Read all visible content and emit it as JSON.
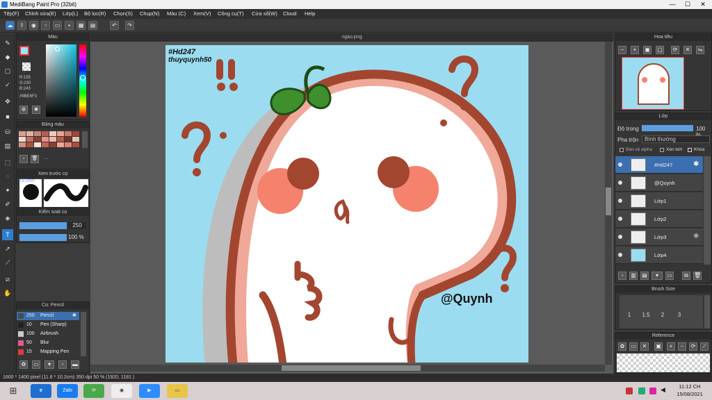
{
  "window": {
    "title": "MediBang Paint Pro (32bit)",
    "minimize": "—",
    "maximize": "☐",
    "close": "✕"
  },
  "menu": [
    "Tệp(F)",
    "Chỉnh sửa(E)",
    "Lớp(L)",
    "Bộ lọc(R)",
    "Chọn(S)",
    "Chụp(N)",
    "Màu (C)",
    "Xem(V)",
    "Công cụ(T)",
    "Cửa sổ(W)",
    "Cloud",
    "Help"
  ],
  "document": {
    "tab": "ngao.png"
  },
  "color_panel": {
    "title": "Màu",
    "r": "R:155",
    "g": "G:230",
    "b": "B:243",
    "hex": "#9BE6F3"
  },
  "palette_panel": {
    "title": "Bảng màu"
  },
  "brush_preview": {
    "title": "Xem trước cọ",
    "size": "18.2mm"
  },
  "brush_control": {
    "title": "Kiểm soát cọ",
    "size": "250",
    "opacity": "100 %"
  },
  "brush_list": {
    "title": "Cọ: Pencil",
    "items": [
      {
        "size": "250",
        "name": "Pencil",
        "color": "#4a4a4a"
      },
      {
        "size": "10",
        "name": "Pen (Sharp)",
        "color": "#222222"
      },
      {
        "size": "100",
        "name": "Airbrush",
        "color": "#cccccc"
      },
      {
        "size": "50",
        "name": "Blur",
        "color": "#e05a8a"
      },
      {
        "size": "15",
        "name": "Mapping Pen",
        "color": "#e03a3a"
      }
    ]
  },
  "navigator": {
    "title": "Hoa tiêu"
  },
  "layer_panel": {
    "title": "Lớp",
    "opacity_label": "Độ trong",
    "opacity_value": "100 %",
    "blend_label": "Pha trộn",
    "blend_value": "Bình thường",
    "protect_alpha": "Bảo vệ alpha",
    "clipping": "Xén bớt",
    "lock": "Khóa",
    "layers": [
      "#Hd247",
      "@Quynh",
      "Lớp1",
      "Lớp2",
      "Lớp3",
      "Lớp4"
    ]
  },
  "brush_size": {
    "title": "Brush Size",
    "sizes": [
      "1",
      "1.5",
      "2",
      "3"
    ]
  },
  "reference": {
    "title": "Reference"
  },
  "artwork": {
    "tag1": "#Hd247",
    "tag2": "thuyquynh50",
    "signature": "@Quynh"
  },
  "status": {
    "text": "1600 * 1400 pixel   (11.6 * 10.2cm)   350 dpi   50 %   (1920, 1181 )"
  },
  "taskbar": {
    "zalo": "Zalo",
    "time": "11:12 CH",
    "date": "15/08/2021"
  }
}
